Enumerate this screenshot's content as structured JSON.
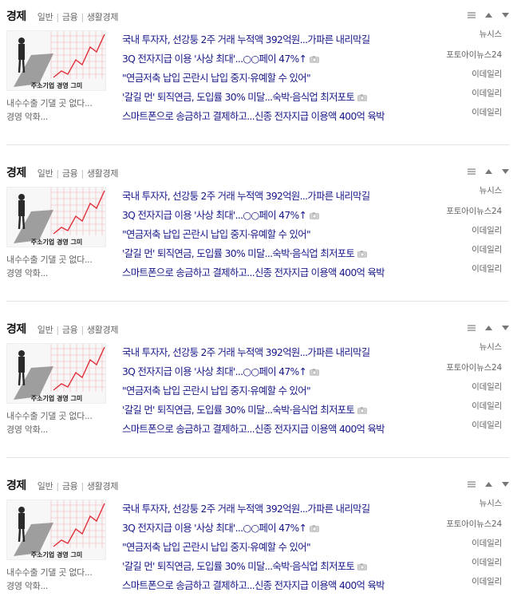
{
  "sections": [
    {
      "title": "경제",
      "subcategories": [
        "일반",
        "금융",
        "생활경제"
      ],
      "thumb_caption": [
        "내수수출 기댈 곳 없다...",
        "경영 악화..."
      ],
      "thumb_text": "주소기업 경영 그미",
      "headlines": [
        {
          "text": "국내 투자자, 선강퉁 2주 거래 누적액 392억원...가파른 내리막길",
          "source": "뉴시스",
          "has_photo": false
        },
        {
          "text": "3Q 전자지급 이용 '사상 최대'...○○페이 47%↑",
          "source": "포토아이뉴스24",
          "has_photo": true
        },
        {
          "text": "\"연금저축 납입 곤란시 납입 중지·유예할 수 있어\"",
          "source": "이데일리",
          "has_photo": false
        },
        {
          "text": "'갈길 먼' 퇴직연금, 도입률 30% 미달...숙박·음식업 최저포토",
          "source": "이데일리",
          "has_photo": true
        },
        {
          "text": "스마트폰으로 송금하고 결제하고...신종 전자지급 이용액 400억 육박",
          "source": "이데일리",
          "has_photo": false
        }
      ]
    },
    {
      "title": "경제",
      "subcategories": [
        "일반",
        "금융",
        "생활경제"
      ],
      "thumb_caption": [
        "내수수출 기댈 곳 없다...",
        "경영 악화..."
      ],
      "thumb_text": "주소기업 경영 그미",
      "headlines": [
        {
          "text": "국내 투자자, 선강퉁 2주 거래 누적액 392억원...가파른 내리막길",
          "source": "뉴시스",
          "has_photo": false
        },
        {
          "text": "3Q 전자지급 이용 '사상 최대'...○○페이 47%↑",
          "source": "포토아이뉴스24",
          "has_photo": true
        },
        {
          "text": "\"연금저축 납입 곤란시 납입 중지·유예할 수 있어\"",
          "source": "이데일리",
          "has_photo": false
        },
        {
          "text": "'갈길 먼' 퇴직연금, 도입률 30% 미달...숙박·음식업 최저포토",
          "source": "이데일리",
          "has_photo": true
        },
        {
          "text": "스마트폰으로 송금하고 결제하고...신종 전자지급 이용액 400억 육박",
          "source": "이데일리",
          "has_photo": false
        }
      ]
    },
    {
      "title": "경제",
      "subcategories": [
        "일반",
        "금융",
        "생활경제"
      ],
      "thumb_caption": [
        "내수수출 기댈 곳 없다...",
        "경영 악화..."
      ],
      "thumb_text": "주소기업 경영 그미",
      "headlines": [
        {
          "text": "국내 투자자, 선강퉁 2주 거래 누적액 392억원...가파른 내리막길",
          "source": "뉴시스",
          "has_photo": false
        },
        {
          "text": "3Q 전자지급 이용 '사상 최대'...○○페이 47%↑",
          "source": "포토아이뉴스24",
          "has_photo": true
        },
        {
          "text": "\"연금저축 납입 곤란시 납입 중지·유예할 수 있어\"",
          "source": "이데일리",
          "has_photo": false
        },
        {
          "text": "'갈길 먼' 퇴직연금, 도입률 30% 미달...숙박·음식업 최저포토",
          "source": "이데일리",
          "has_photo": true
        },
        {
          "text": "스마트폰으로 송금하고 결제하고...신종 전자지급 이용액 400억 육박",
          "source": "이데일리",
          "has_photo": false
        }
      ]
    },
    {
      "title": "경제",
      "subcategories": [
        "일반",
        "금융",
        "생활경제"
      ],
      "thumb_caption": [
        "내수수출 기댈 곳 없다...",
        "경영 악화..."
      ],
      "thumb_text": "주소기업 경영 그미",
      "headlines": [
        {
          "text": "국내 투자자, 선강퉁 2주 거래 누적액 392억원...가파른 내리막길",
          "source": "뉴시스",
          "has_photo": false
        },
        {
          "text": "3Q 전자지급 이용 '사상 최대'...○○페이 47%↑",
          "source": "포토아이뉴스24",
          "has_photo": true
        },
        {
          "text": "\"연금저축 납입 곤란시 납입 중지·유예할 수 있어\"",
          "source": "이데일리",
          "has_photo": false
        },
        {
          "text": "'갈길 먼' 퇴직연금, 도입률 30% 미달...숙박·음식업 최저포토",
          "source": "이데일리",
          "has_photo": true
        },
        {
          "text": "스마트폰으로 송금하고 결제하고...신종 전자지급 이용액 400억 육박",
          "source": "이데일리",
          "has_photo": false
        }
      ]
    }
  ],
  "controls": [
    "menu-icon",
    "move-up-icon",
    "move-down-icon"
  ],
  "colors": {
    "headline": "#1a1a8a",
    "meta": "#666666",
    "divider": "#e4e4e4",
    "thumb_line": "#e0303a"
  }
}
